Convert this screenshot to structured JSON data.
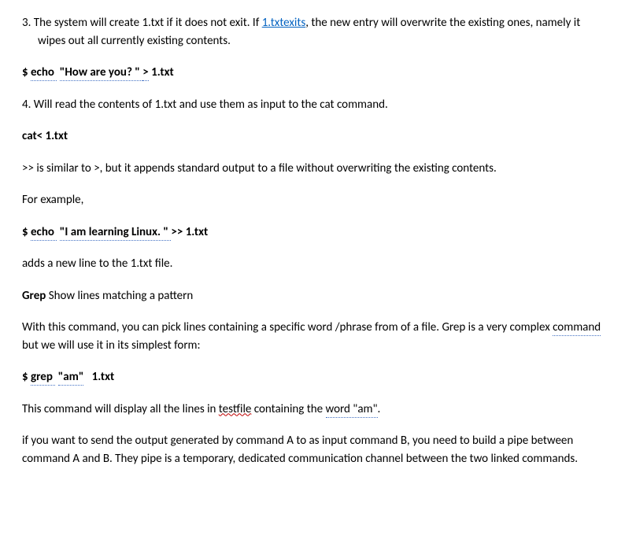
{
  "p1_prefix": "3. ",
  "p1_a": "The system will create 1.txt if it does not exit. If ",
  "p1_link": "1.txtexits",
  "p1_b": ", the new entry will overwrite the existing ones, namely it wipes out all currently existing contents.",
  "p2_a": "$ ",
  "p2_echo": "echo ",
  "p2_space": " ",
  "p2_msg": "\"How are you? \" ",
  "p2_gt": ">",
  "p2_b": " 1.txt",
  "p3": "4. Will read the contents of 1.txt and use them as input to the cat command.",
  "p4": "cat< 1.txt",
  "p5": ">> is similar to >, but it appends standard output to a file without overwriting the existing contents.",
  "p6": "For example,",
  "p7_a": "$ ",
  "p7_echo": "echo ",
  "p7_space": " ",
  "p7_msg": "\"I am learning Linux. \" ",
  "p7_b": ">> 1.txt",
  "p8": "adds a new line to the 1.txt file.",
  "p9_a": "Grep",
  "p9_b": " Show lines matching a pattern",
  "p10_a": "With this command, you can pick lines containing a specific word /phrase from of a file. Grep is a very complex ",
  "p10_cmd": "command",
  "p10_b": " but we will use it in its simplest form:",
  "p11_a": "$ ",
  "p11_grep": "grep ",
  "p11_space": " ",
  "p11_am": "\"am\"",
  "p11_b": "   1.txt",
  "p12_a": "This command will display all the lines in ",
  "p12_testfile": "testfile",
  "p12_b": " containing the ",
  "p12_wordam": "word \"am\"",
  "p12_c": ".",
  "p13": "if you want to send the output generated by command A to as input command B, you need to build a pipe between command A and B. They pipe is a temporary, dedicated communication channel between the two linked commands."
}
